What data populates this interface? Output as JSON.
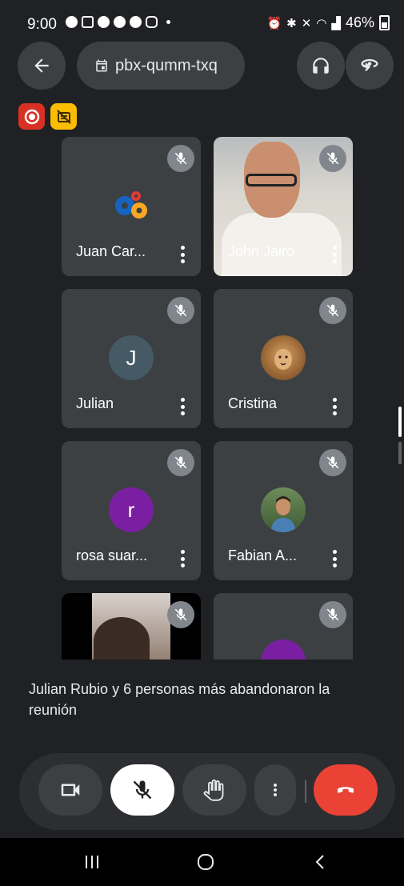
{
  "status_bar": {
    "time": "9:00",
    "battery": "46%"
  },
  "header": {
    "meeting_code": "pbx-qumm-txq"
  },
  "participants": [
    {
      "name": "Juan Car...",
      "avatar_letter": "",
      "avatar_color": "#ffffff",
      "has_video": false
    },
    {
      "name": "John Jairo",
      "avatar_letter": "",
      "has_video": true
    },
    {
      "name": "Julian",
      "avatar_letter": "J",
      "avatar_color": "#455a64",
      "has_video": false
    },
    {
      "name": "Cristina",
      "avatar_letter": "",
      "has_video": false
    },
    {
      "name": "rosa suar...",
      "avatar_letter": "r",
      "avatar_color": "#7b1fa2",
      "has_video": false
    },
    {
      "name": "Fabian A...",
      "avatar_letter": "",
      "has_video": false
    },
    {
      "name": "",
      "has_video": true
    },
    {
      "name": "",
      "avatar_color": "#7b1fa2",
      "has_video": false
    }
  ],
  "notice": {
    "text": "Julian Rubio y 6 personas más abandonaron la reunión"
  },
  "colors": {
    "end_call": "#ea4335",
    "record": "#d93025",
    "annotation": "#fbbc04",
    "background": "#202124"
  }
}
